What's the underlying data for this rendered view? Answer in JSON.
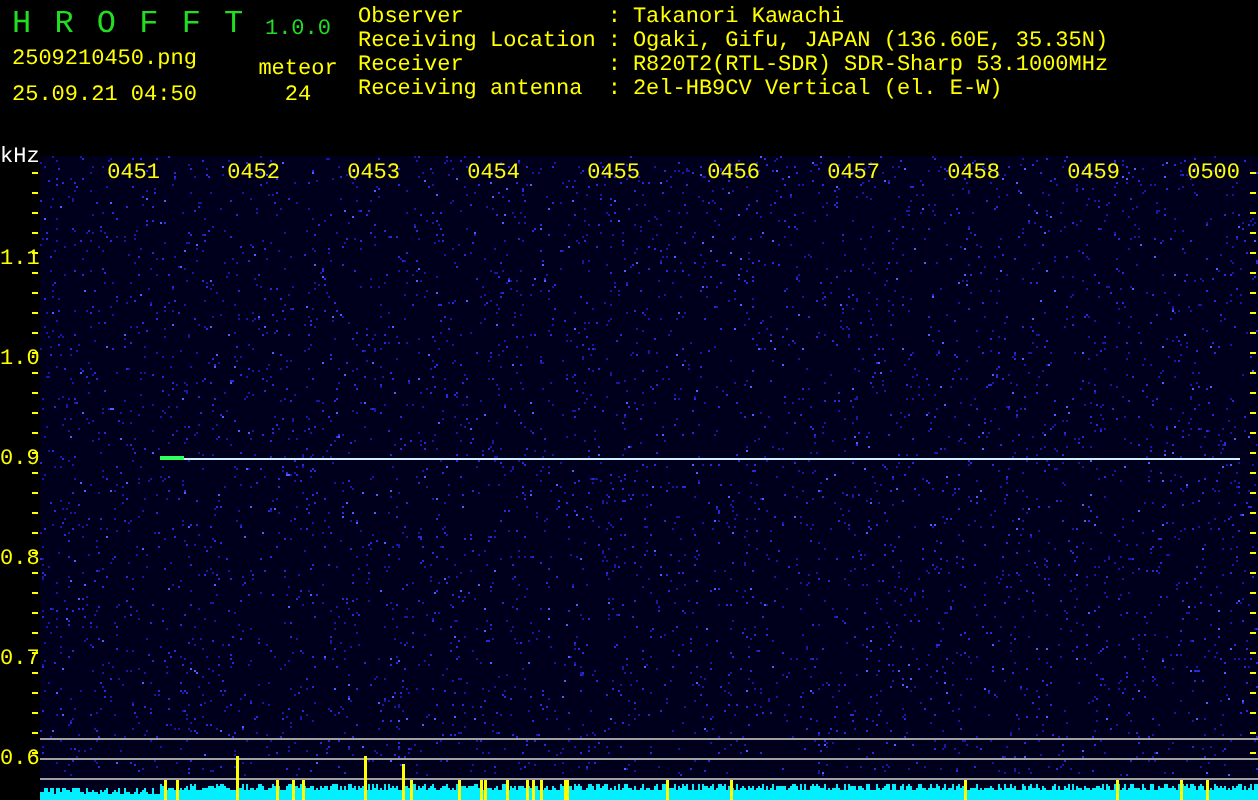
{
  "app": {
    "name": "H R O F F T",
    "version": "1.0.0"
  },
  "file": {
    "name": "2509210450.png",
    "datetime": "25.09.21 04:50"
  },
  "meteor": {
    "label": "meteor",
    "count": "24"
  },
  "info": [
    {
      "label": "Observer",
      "sep": ":",
      "value": "Takanori Kawachi"
    },
    {
      "label": "Receiving Location",
      "sep": ":",
      "value": "Ogaki, Gifu, JAPAN (136.60E, 35.35N)"
    },
    {
      "label": "Receiver",
      "sep": ":",
      "value": "R820T2(RTL-SDR) SDR-Sharp 53.1000MHz"
    },
    {
      "label": "Receiving antenna",
      "sep": ":",
      "value": "2el-HB9CV Vertical (el. E-W)"
    }
  ],
  "spectrogram": {
    "unit": "kHz",
    "time_labels": [
      "0451",
      "0452",
      "0453",
      "0454",
      "0455",
      "0456",
      "0457",
      "0458",
      "0459",
      "0500"
    ],
    "freq_labels": [
      "1.1",
      "1.0",
      "0.9",
      "0.8",
      "0.7",
      "0.6"
    ]
  }
}
